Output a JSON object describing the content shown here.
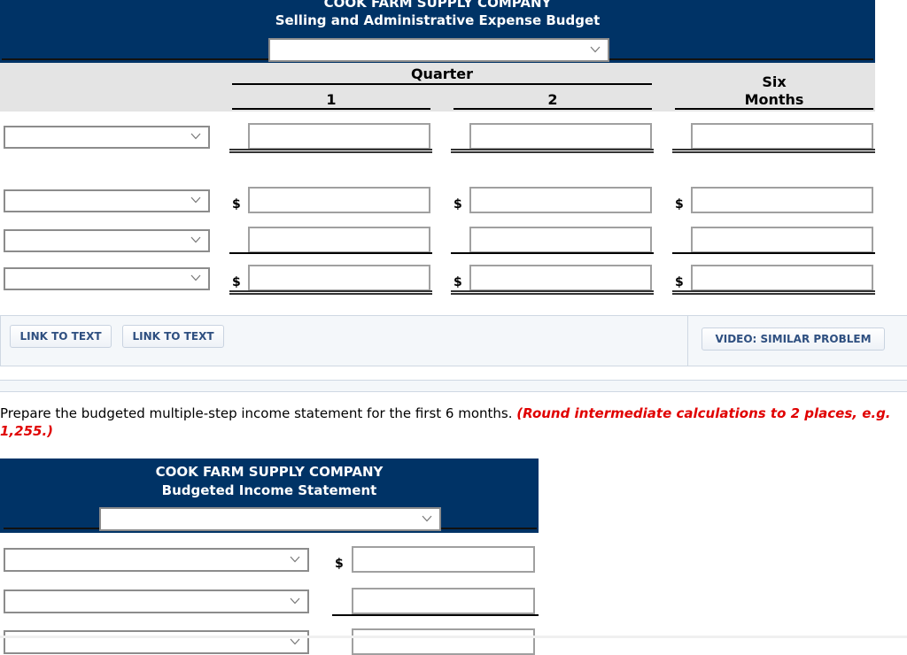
{
  "budget1": {
    "company": "COOK FARM SUPPLY COMPANY",
    "title": "Selling and Administrative Expense Budget",
    "period_select": {
      "value": ""
    },
    "columns": {
      "group_label": "Quarter",
      "q1": "1",
      "q2": "2",
      "total_line1": "Six",
      "total_line2": "Months"
    },
    "rows": [
      {
        "label_select": "",
        "currency": "",
        "q1": "",
        "q2": "",
        "six_months": "",
        "underline": "double"
      },
      {
        "label_select": "",
        "currency": "$",
        "q1": "",
        "q2": "",
        "six_months": "",
        "underline": "none"
      },
      {
        "label_select": "",
        "currency": "",
        "q1": "",
        "q2": "",
        "six_months": "",
        "underline": "single"
      },
      {
        "label_select": "",
        "currency": "$",
        "q1": "",
        "q2": "",
        "six_months": "",
        "underline": "double"
      }
    ]
  },
  "links": {
    "link1": "LINK TO TEXT",
    "link2": "LINK TO TEXT",
    "video": "VIDEO: SIMILAR PROBLEM"
  },
  "instruction": {
    "text": "Prepare the budgeted multiple-step income statement for the first 6 months.",
    "note": "(Round intermediate calculations to 2 places, e.g. 1,255.)"
  },
  "budget2": {
    "company": "COOK FARM SUPPLY COMPANY",
    "title": "Budgeted Income Statement",
    "period_select": {
      "value": ""
    },
    "rows": [
      {
        "label_select": "",
        "currency": "$",
        "amount": ""
      },
      {
        "label_select": "",
        "currency": "",
        "amount": ""
      },
      {
        "label_select": "",
        "currency": "",
        "amount": ""
      }
    ]
  },
  "colors": {
    "header_navy": "#003366",
    "column_header_gray": "#e4e4e4",
    "link_bar_bg": "#f4f7fa",
    "button_text": "#2e4f80",
    "note_red": "#e00000"
  }
}
